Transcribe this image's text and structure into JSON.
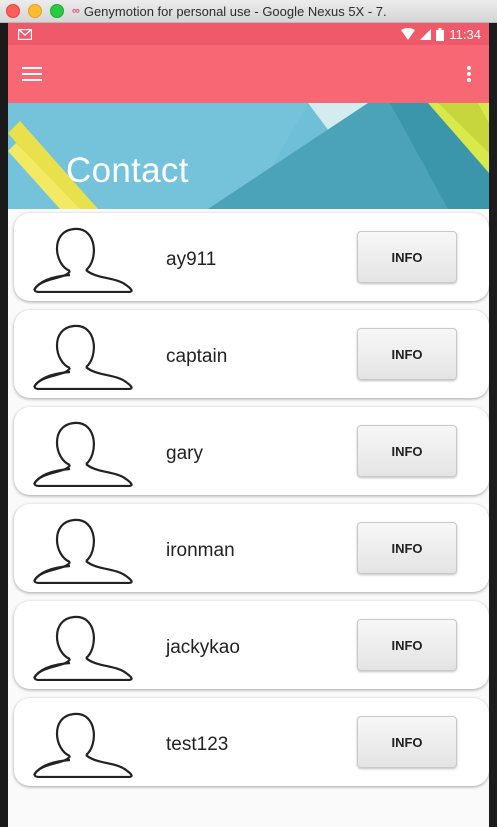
{
  "window": {
    "title": "Genymotion for personal use - Google Nexus 5X - 7."
  },
  "statusbar": {
    "time": "11:34",
    "left_icon": "gmail-icon",
    "right_icons": [
      "wifi-icon",
      "signal-icon",
      "battery-icon"
    ]
  },
  "appbar": {
    "menu_icon": "hamburger-menu-icon",
    "overflow_icon": "overflow-menu-icon"
  },
  "banner": {
    "title": "Contact"
  },
  "contacts": [
    {
      "name": "ay911",
      "button": "INFO"
    },
    {
      "name": "captain",
      "button": "INFO"
    },
    {
      "name": "gary",
      "button": "INFO"
    },
    {
      "name": "ironman",
      "button": "INFO"
    },
    {
      "name": "jackykao",
      "button": "INFO"
    },
    {
      "name": "test123",
      "button": "INFO"
    }
  ],
  "colors": {
    "statusbar": "#ef5a6a",
    "appbar": "#f86774"
  }
}
